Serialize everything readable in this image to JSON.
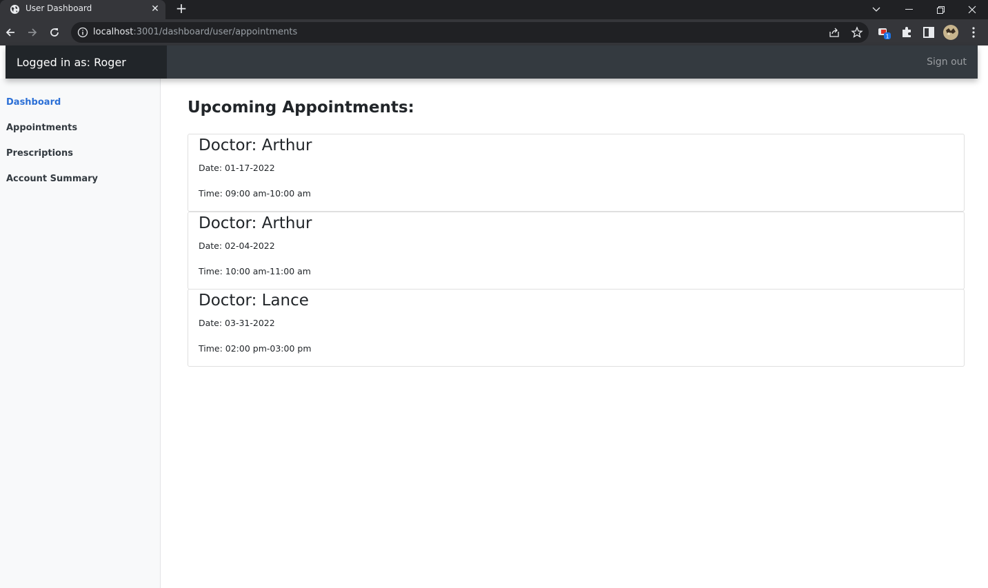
{
  "browser": {
    "tab_title": "User Dashboard",
    "url_host": "localhost",
    "url_rest": ":3001/dashboard/user/appointments",
    "extension_badge": "1"
  },
  "navbar": {
    "brand": "Logged in as: Roger",
    "signout_label": "Sign out"
  },
  "sidebar": {
    "items": [
      {
        "label": "Dashboard",
        "active": true
      },
      {
        "label": "Appointments",
        "active": false
      },
      {
        "label": "Prescriptions",
        "active": false
      },
      {
        "label": "Account Summary",
        "active": false
      }
    ]
  },
  "main": {
    "title": "Upcoming Appointments:",
    "appointments": [
      {
        "doctor": "Doctor: Arthur",
        "date": "Date: 01-17-2022",
        "time": "Time: 09:00 am-10:00 am"
      },
      {
        "doctor": "Doctor: Arthur",
        "date": "Date: 02-04-2022",
        "time": "Time: 10:00 am-11:00 am"
      },
      {
        "doctor": "Doctor: Lance",
        "date": "Date: 03-31-2022",
        "time": "Time: 02:00 pm-03:00 pm"
      }
    ]
  },
  "colors": {
    "accent": "#2b6fd6",
    "navbar": "#343a40",
    "brand_bg": "#212529"
  }
}
